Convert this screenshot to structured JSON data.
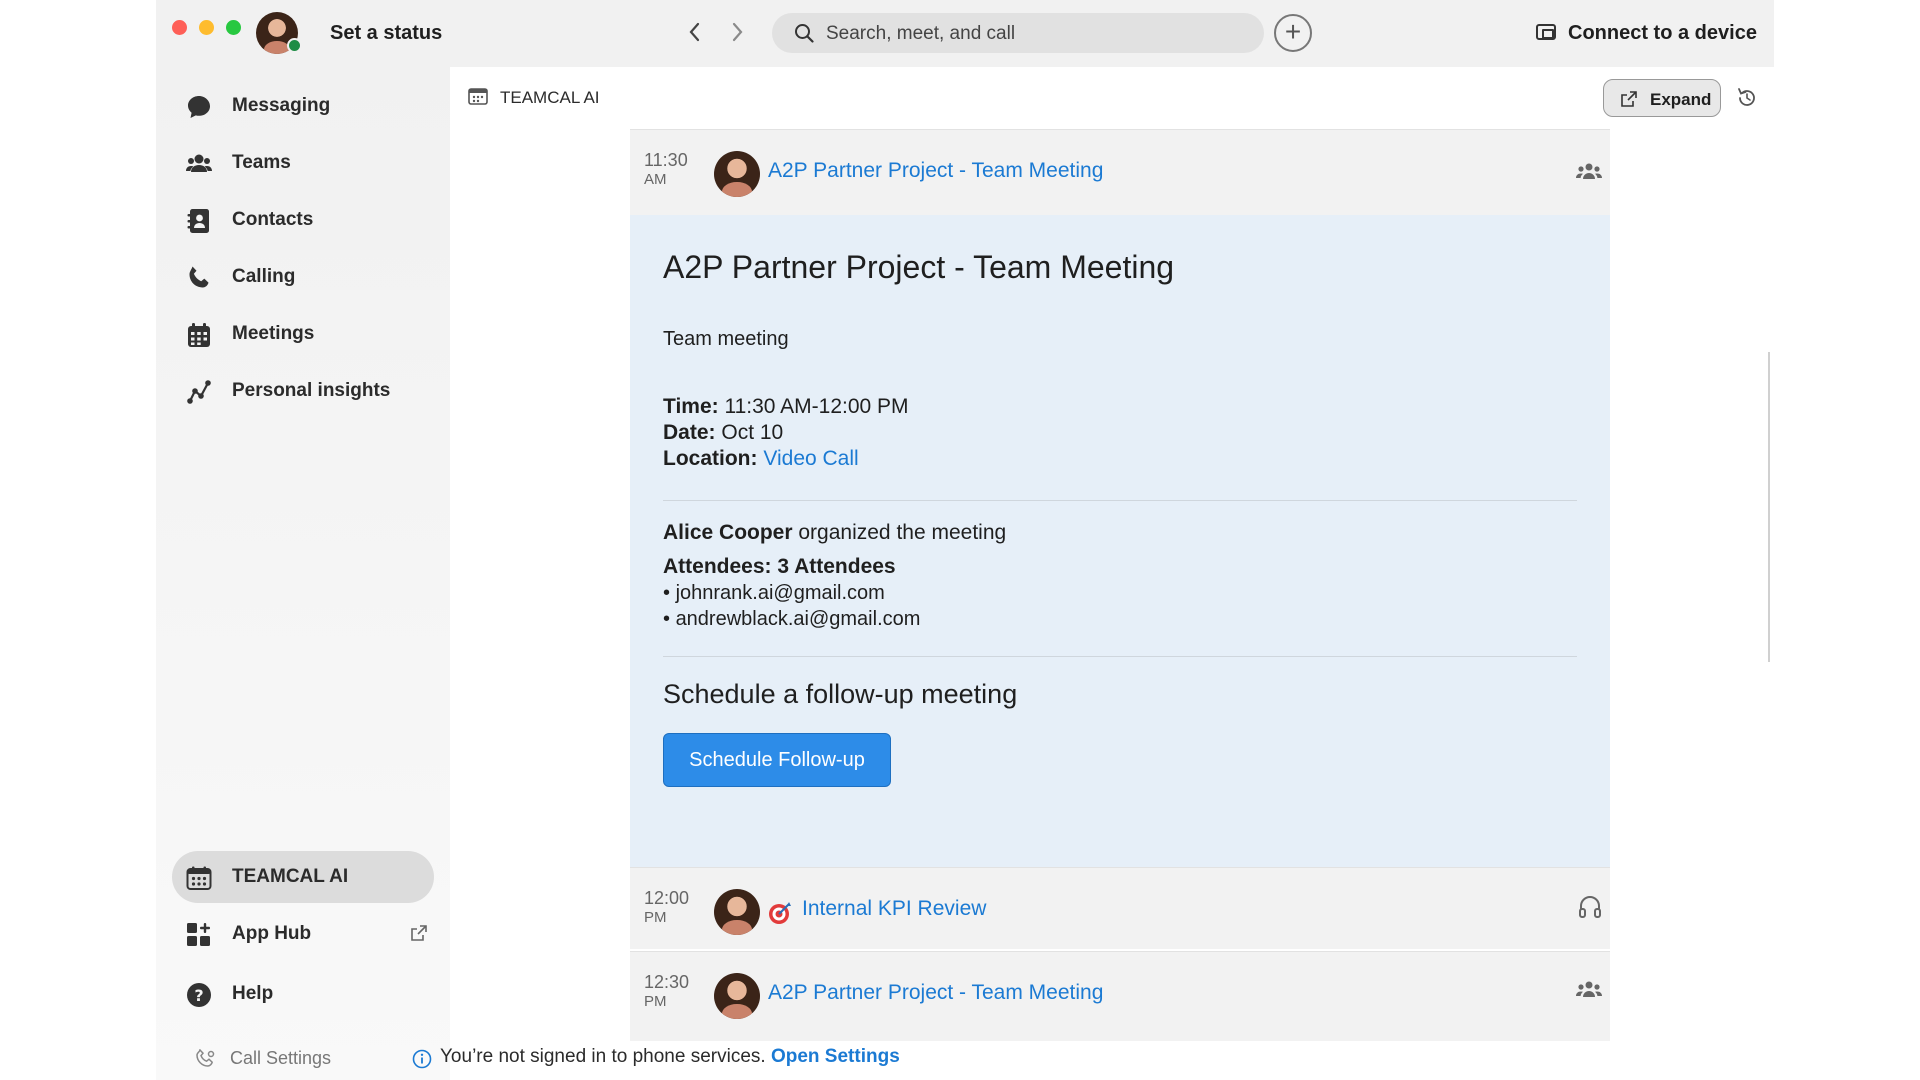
{
  "titlebar": {
    "status_label": "Set a status",
    "search_placeholder": "Search, meet, and call",
    "device_label": "Connect to a device"
  },
  "sidebar": {
    "items": [
      {
        "label": "Messaging",
        "icon": "chat-bubble-icon"
      },
      {
        "label": "Teams",
        "icon": "people-icon"
      },
      {
        "label": "Contacts",
        "icon": "contacts-icon"
      },
      {
        "label": "Calling",
        "icon": "phone-icon"
      },
      {
        "label": "Meetings",
        "icon": "calendar-icon"
      },
      {
        "label": "Personal insights",
        "icon": "insights-icon"
      }
    ],
    "bottom": [
      {
        "label": "TEAMCAL AI",
        "icon": "calendar-app-icon",
        "active": true
      },
      {
        "label": "App Hub",
        "icon": "app-grid-icon"
      },
      {
        "label": "Help",
        "icon": "help-icon"
      }
    ],
    "call_settings": "Call Settings"
  },
  "main": {
    "app_title": "TEAMCAL AI",
    "expand_label": "Expand",
    "events": [
      {
        "time": "11:30",
        "ampm": "AM",
        "title": "A2P Partner Project - Team Meeting",
        "glyph": "people-icon"
      },
      {
        "time": "12:00",
        "ampm": "PM",
        "title": "Internal KPI Review",
        "glyph": "headphones-icon"
      },
      {
        "time": "12:30",
        "ampm": "PM",
        "title": "A2P Partner Project - Team Meeting",
        "glyph": "people-icon"
      }
    ],
    "detail": {
      "title": "A2P Partner Project - Team Meeting",
      "description": "Team meeting",
      "time_label": "Time:",
      "time_value": "11:30 AM-12:00 PM",
      "date_label": "Date:",
      "date_value": "Oct 10",
      "location_label": "Location:",
      "location_value": "Video Call",
      "organizer": "Alice Cooper",
      "organizer_suffix": "organized the meeting",
      "attendees_label": "Attendees: 3 Attendees",
      "attendees": [
        "johnrank.ai@gmail.com",
        "andrewblack.ai@gmail.com"
      ],
      "followup_heading": "Schedule a follow-up meeting",
      "followup_button": "Schedule Follow-up"
    }
  },
  "notice": {
    "text": "You’re not signed in to phone services.",
    "link": "Open Settings"
  },
  "colors": {
    "accent": "#1b7ad3",
    "button": "#2d8ce8",
    "detail_bg": "#e6eff8"
  }
}
